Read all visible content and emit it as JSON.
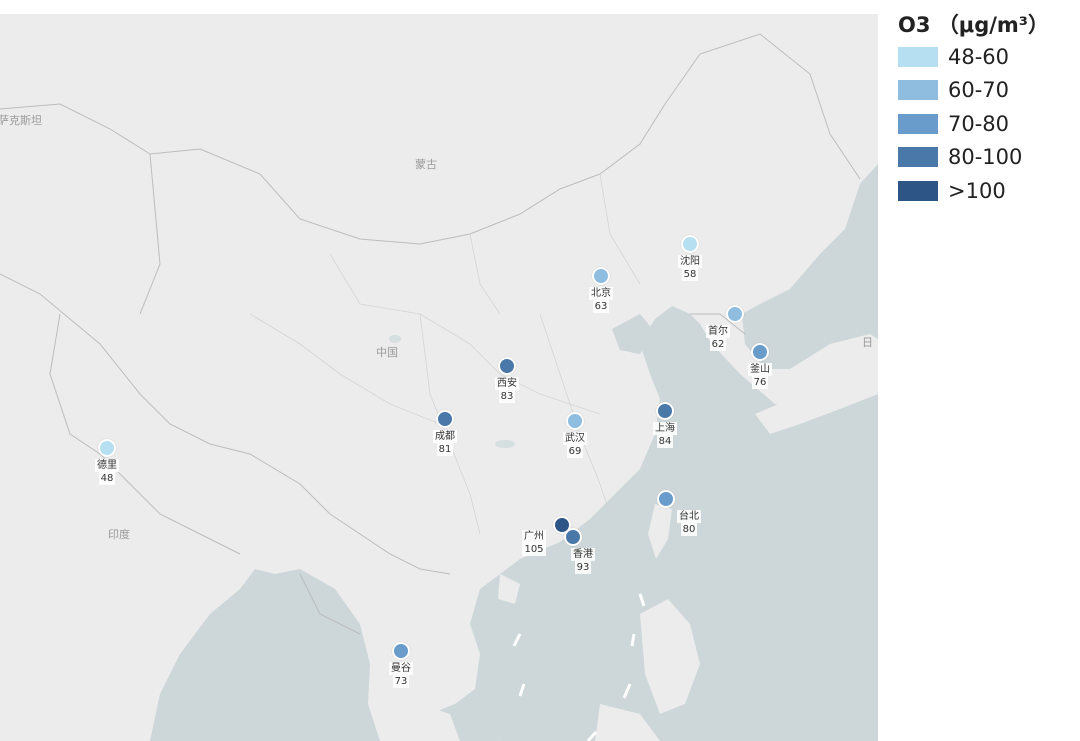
{
  "legend": {
    "title": "O3 （μg/m³）",
    "items": [
      {
        "label": "48-60",
        "color": "#b7dff2"
      },
      {
        "label": "60-70",
        "color": "#8fbde0"
      },
      {
        "label": "70-80",
        "color": "#6a9ccb"
      },
      {
        "label": "80-100",
        "color": "#4a78a9"
      },
      {
        "label": ">100",
        "color": "#2d5687"
      }
    ]
  },
  "map_labels": {
    "mongolia": "蒙古",
    "china": "中国",
    "india": "印度",
    "kazakhstan": "萨克斯坦",
    "japan": "日"
  },
  "cities": [
    {
      "key": "shenyang",
      "name": "沈阳",
      "value": "58",
      "color": "#b7dff2"
    },
    {
      "key": "beijing",
      "name": "北京",
      "value": "63",
      "color": "#8fbde0"
    },
    {
      "key": "seoul",
      "name": "首尔",
      "value": "62",
      "color": "#8fbde0"
    },
    {
      "key": "busan",
      "name": "釜山",
      "value": "76",
      "color": "#6a9ccb"
    },
    {
      "key": "xian",
      "name": "西安",
      "value": "83",
      "color": "#4a78a9"
    },
    {
      "key": "chengdu",
      "name": "成都",
      "value": "81",
      "color": "#4a78a9"
    },
    {
      "key": "wuhan",
      "name": "武汉",
      "value": "69",
      "color": "#8fbde0"
    },
    {
      "key": "shanghai",
      "name": "上海",
      "value": "84",
      "color": "#4a78a9"
    },
    {
      "key": "taipei",
      "name": "台北",
      "value": "80",
      "color": "#6a9ccb"
    },
    {
      "key": "guangzhou",
      "name": "广州",
      "value": "105",
      "color": "#2d5687"
    },
    {
      "key": "hongkong",
      "name": "香港",
      "value": "93",
      "color": "#4a78a9"
    },
    {
      "key": "delhi",
      "name": "德里",
      "value": "48",
      "color": "#b7dff2"
    },
    {
      "key": "bangkok",
      "name": "曼谷",
      "value": "73",
      "color": "#6a9ccb"
    }
  ]
}
